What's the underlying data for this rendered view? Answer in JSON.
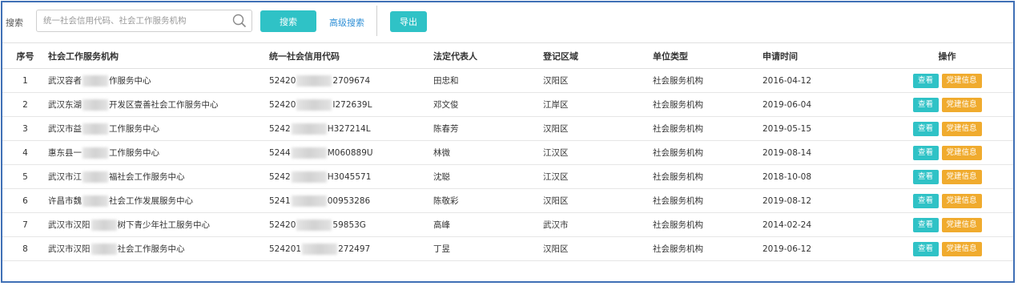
{
  "toolbar": {
    "search_label": "搜索",
    "search_placeholder": "统一社会信用代码、社会工作服务机构",
    "search_button": "搜索",
    "advanced_search": "高级搜索",
    "export_button": "导出"
  },
  "table": {
    "headers": [
      "序号",
      "社会工作服务机构",
      "统一社会信用代码",
      "法定代表人",
      "登记区域",
      "单位类型",
      "申请时间",
      "操作"
    ],
    "actions": {
      "view": "查看",
      "party": "党建信息"
    },
    "rows": [
      {
        "idx": "1",
        "org_a": "武汉容者",
        "org_b": "作服务中心",
        "code_a": "52420",
        "code_b": "2709674",
        "rep": "田忠和",
        "region": "汉阳区",
        "type": "社会服务机构",
        "date": "2016-04-12"
      },
      {
        "idx": "2",
        "org_a": "武汉东湖",
        "org_b": "开发区壹善社会工作服务中心",
        "code_a": "52420",
        "code_b": "I272639L",
        "rep": "邓文俊",
        "region": "江岸区",
        "type": "社会服务机构",
        "date": "2019-06-04"
      },
      {
        "idx": "3",
        "org_a": "武汉市益",
        "org_b": "工作服务中心",
        "code_a": "5242",
        "code_b": "H327214L",
        "rep": "陈春芳",
        "region": "汉阳区",
        "type": "社会服务机构",
        "date": "2019-05-15"
      },
      {
        "idx": "4",
        "org_a": "惠东县一",
        "org_b": "工作服务中心",
        "code_a": "5244",
        "code_b": "M060889U",
        "rep": "林微",
        "region": "江汉区",
        "type": "社会服务机构",
        "date": "2019-08-14"
      },
      {
        "idx": "5",
        "org_a": "武汉市江",
        "org_b": "福社会工作服务中心",
        "code_a": "5242",
        "code_b": "H3045571",
        "rep": "沈聪",
        "region": "江汉区",
        "type": "社会服务机构",
        "date": "2018-10-08"
      },
      {
        "idx": "6",
        "org_a": "许昌市魏",
        "org_b": "社会工作发展服务中心",
        "code_a": "5241",
        "code_b": "00953286",
        "rep": "陈敬彩",
        "region": "汉阳区",
        "type": "社会服务机构",
        "date": "2019-08-12"
      },
      {
        "idx": "7",
        "org_a": "武汉市汉阳",
        "org_b": "树下青少年社工服务中心",
        "code_a": "52420",
        "code_b": "59853G",
        "rep": "高峰",
        "region": "武汉市",
        "type": "社会服务机构",
        "date": "2014-02-24"
      },
      {
        "idx": "8",
        "org_a": "武汉市汉阳",
        "org_b": "社会工作服务中心",
        "code_a": "524201",
        "code_b": "272497",
        "rep": "丁昱",
        "region": "汉阳区",
        "type": "社会服务机构",
        "date": "2019-06-12"
      }
    ]
  }
}
